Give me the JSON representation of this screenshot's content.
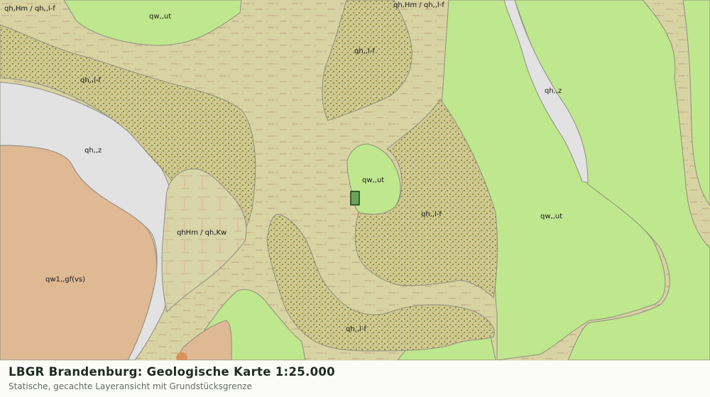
{
  "header": {
    "title": "LBGR Brandenburg: Geologische Karte 1:25.000",
    "subtitle": "Statische, gecachte Layeransicht mit Grundstücksgrenze"
  },
  "map": {
    "unit_labels": {
      "qhHm_qhlf_topleft": "qh,Hm / qh,,l-f",
      "qw_ut_top": "qw,,ut",
      "qhHm_qhlf_top": "qh,Hm / qh,,l-f",
      "qh_lf_center_top": "qh,,l-f",
      "qh_lf_left": "qh,,l-f",
      "qh_z_right": "qh,,z",
      "qh_z_left": "qh,,z",
      "qw_ut_center": "qw,,ut",
      "qhHm_Kw": "qhHm / qh,Kw",
      "qh_lf_center": "qh,,l-f",
      "qw_ut_right": "qw,,ut",
      "qw1_gf": "qw1,,gf(vs)",
      "qh_lf_bottom": "qh,,l-f"
    },
    "colors": {
      "base_holocene": "#d8d3a2",
      "sand_fluviatile": "#cbc58f",
      "weichsel_green": "#bfe78d",
      "dune_grey": "#e2e2e2",
      "glacifluvial_tan": "#dfb894",
      "peat_hatch": "#d7d4a6",
      "parcel_fill": "#6aa35a",
      "parcel_outline": "#1f4a24",
      "outline": "#8e8e80"
    }
  }
}
